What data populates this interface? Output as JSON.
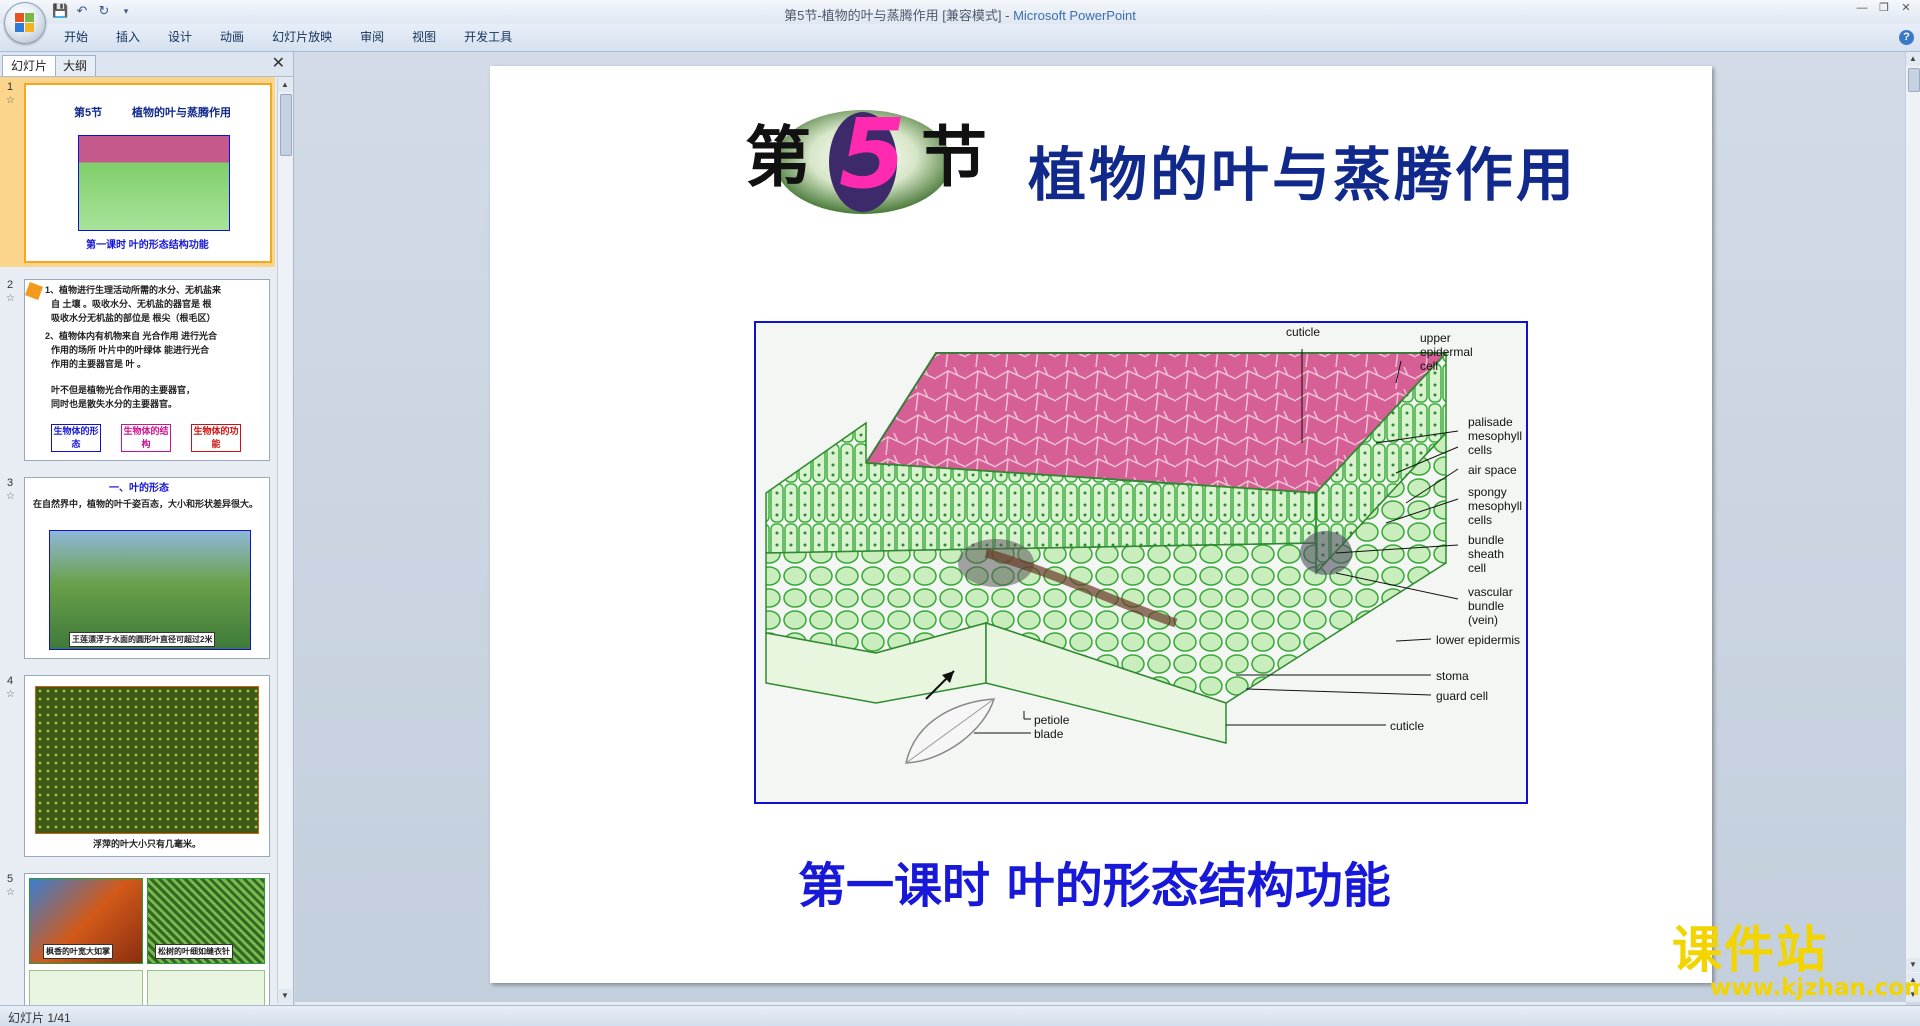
{
  "window": {
    "title": "第5节-植物的叶与蒸腾作用 [兼容模式]",
    "app_name": "Microsoft PowerPoint",
    "controls": [
      "minimize",
      "restore",
      "close"
    ]
  },
  "ribbon": {
    "tabs": [
      "开始",
      "插入",
      "设计",
      "动画",
      "幻灯片放映",
      "审阅",
      "视图",
      "开发工具"
    ]
  },
  "left_pane": {
    "tabs": [
      "幻灯片",
      "大纲"
    ],
    "active_tab": "幻灯片",
    "thumbnails": [
      {
        "number": "1",
        "title_badge": "第5节",
        "title": "植物的叶与蒸腾作用",
        "subtitle": "第一课时 叶的形态结构功能"
      },
      {
        "number": "2",
        "lines": [
          "1、植物进行生理活动所需的水分、无机盐来",
          "自 土壤 。吸收水分、无机盐的器官是 根",
          "吸收水分无机盐的部位是 根尖（根毛区）",
          "2、植物体内有机物来自 光合作用 进行光合",
          "作用的场所 叶片中的叶绿体 能进行光合",
          "作用的主要器官是 叶 。",
          "叶不但是植物光合作用的主要器官，",
          "同时也是散失水分的主要器官。"
        ],
        "boxes": [
          "生物体的形 态",
          "生物体的结 构",
          "生物体的功 能"
        ]
      },
      {
        "number": "3",
        "heading": "一、叶的形态",
        "text": "在自然界中，植物的叶千姿百态，大小和形状差异很大。",
        "caption": "王莲漂浮于水面的圆形叶直径可超过2米"
      },
      {
        "number": "4",
        "caption": "浮萍的叶大小只有几毫米。"
      },
      {
        "number": "5",
        "captions": [
          "枫香的叶宽大如掌",
          "松树的叶细如缝衣针"
        ]
      }
    ]
  },
  "slide": {
    "badge_left": "第",
    "badge_number": "5",
    "badge_right": "节",
    "heading": "植物的叶与蒸腾作用",
    "subtitle": "第一课时 叶的形态结构功能",
    "diagram_labels": [
      "cuticle",
      "upper epidermal cell",
      "palisade mesophyll cells",
      "air space",
      "spongy mesophyll cells",
      "bundle sheath cell",
      "vascular bundle (vein)",
      "lower epidermis",
      "stoma",
      "guard cell",
      "cuticle",
      "petiole",
      "blade"
    ]
  },
  "status_bar": {
    "slide_indicator": "幻灯片 1/41"
  },
  "watermark": {
    "main": "课件站",
    "url": "www.kjzhan.com"
  }
}
